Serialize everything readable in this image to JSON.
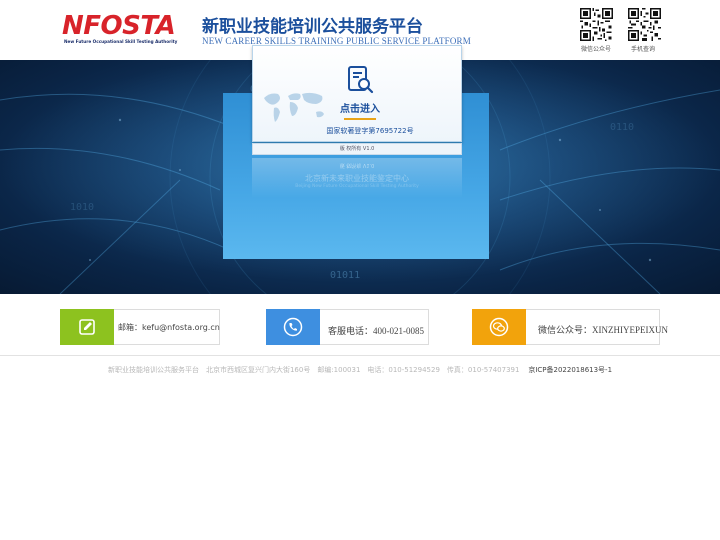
{
  "header": {
    "logo_text": "NFOSTA",
    "logo_tagline": "New Future Occupational Skill Testing Authority",
    "title": "新职业技能培训公共服务平台",
    "subtitle": "NEW CAREER SKILLS TRAINING PUBLIC SERVICE PLATFORM",
    "qr_codes": [
      {
        "label": "微信公众号",
        "icon": "qr-code-icon"
      },
      {
        "label": "手机查询",
        "icon": "qr-code-icon"
      }
    ]
  },
  "banner": {
    "enter_label": "点击进入",
    "registration": "国家软著登字第7695722号",
    "strip_text": "版 权所有 V1.0",
    "reflection_title": "北京新未来职业技能鉴定中心",
    "reflection_sub": "Beijing New Future Occupational Skill Testing Authority",
    "card_icon": "document-search-icon"
  },
  "contacts": [
    {
      "icon": "edit-icon",
      "text": "邮箱：kefu@nfosta.org.cn",
      "color": "#8dc21f"
    },
    {
      "icon": "phone-icon",
      "text": "客服电话：400-021-0085",
      "color": "#3e8fe0"
    },
    {
      "icon": "wechat-icon",
      "text": "微信公众号：XINZHIYEPEIXUN",
      "color": "#f2a30c"
    }
  ],
  "footer": {
    "info": "新职业技能培训公共服务平台　北京市西城区复兴门内大街160号　邮编:100031　电话：010-51294529　传真：010-57407391",
    "icp": "京ICP备2022018613号-1"
  }
}
